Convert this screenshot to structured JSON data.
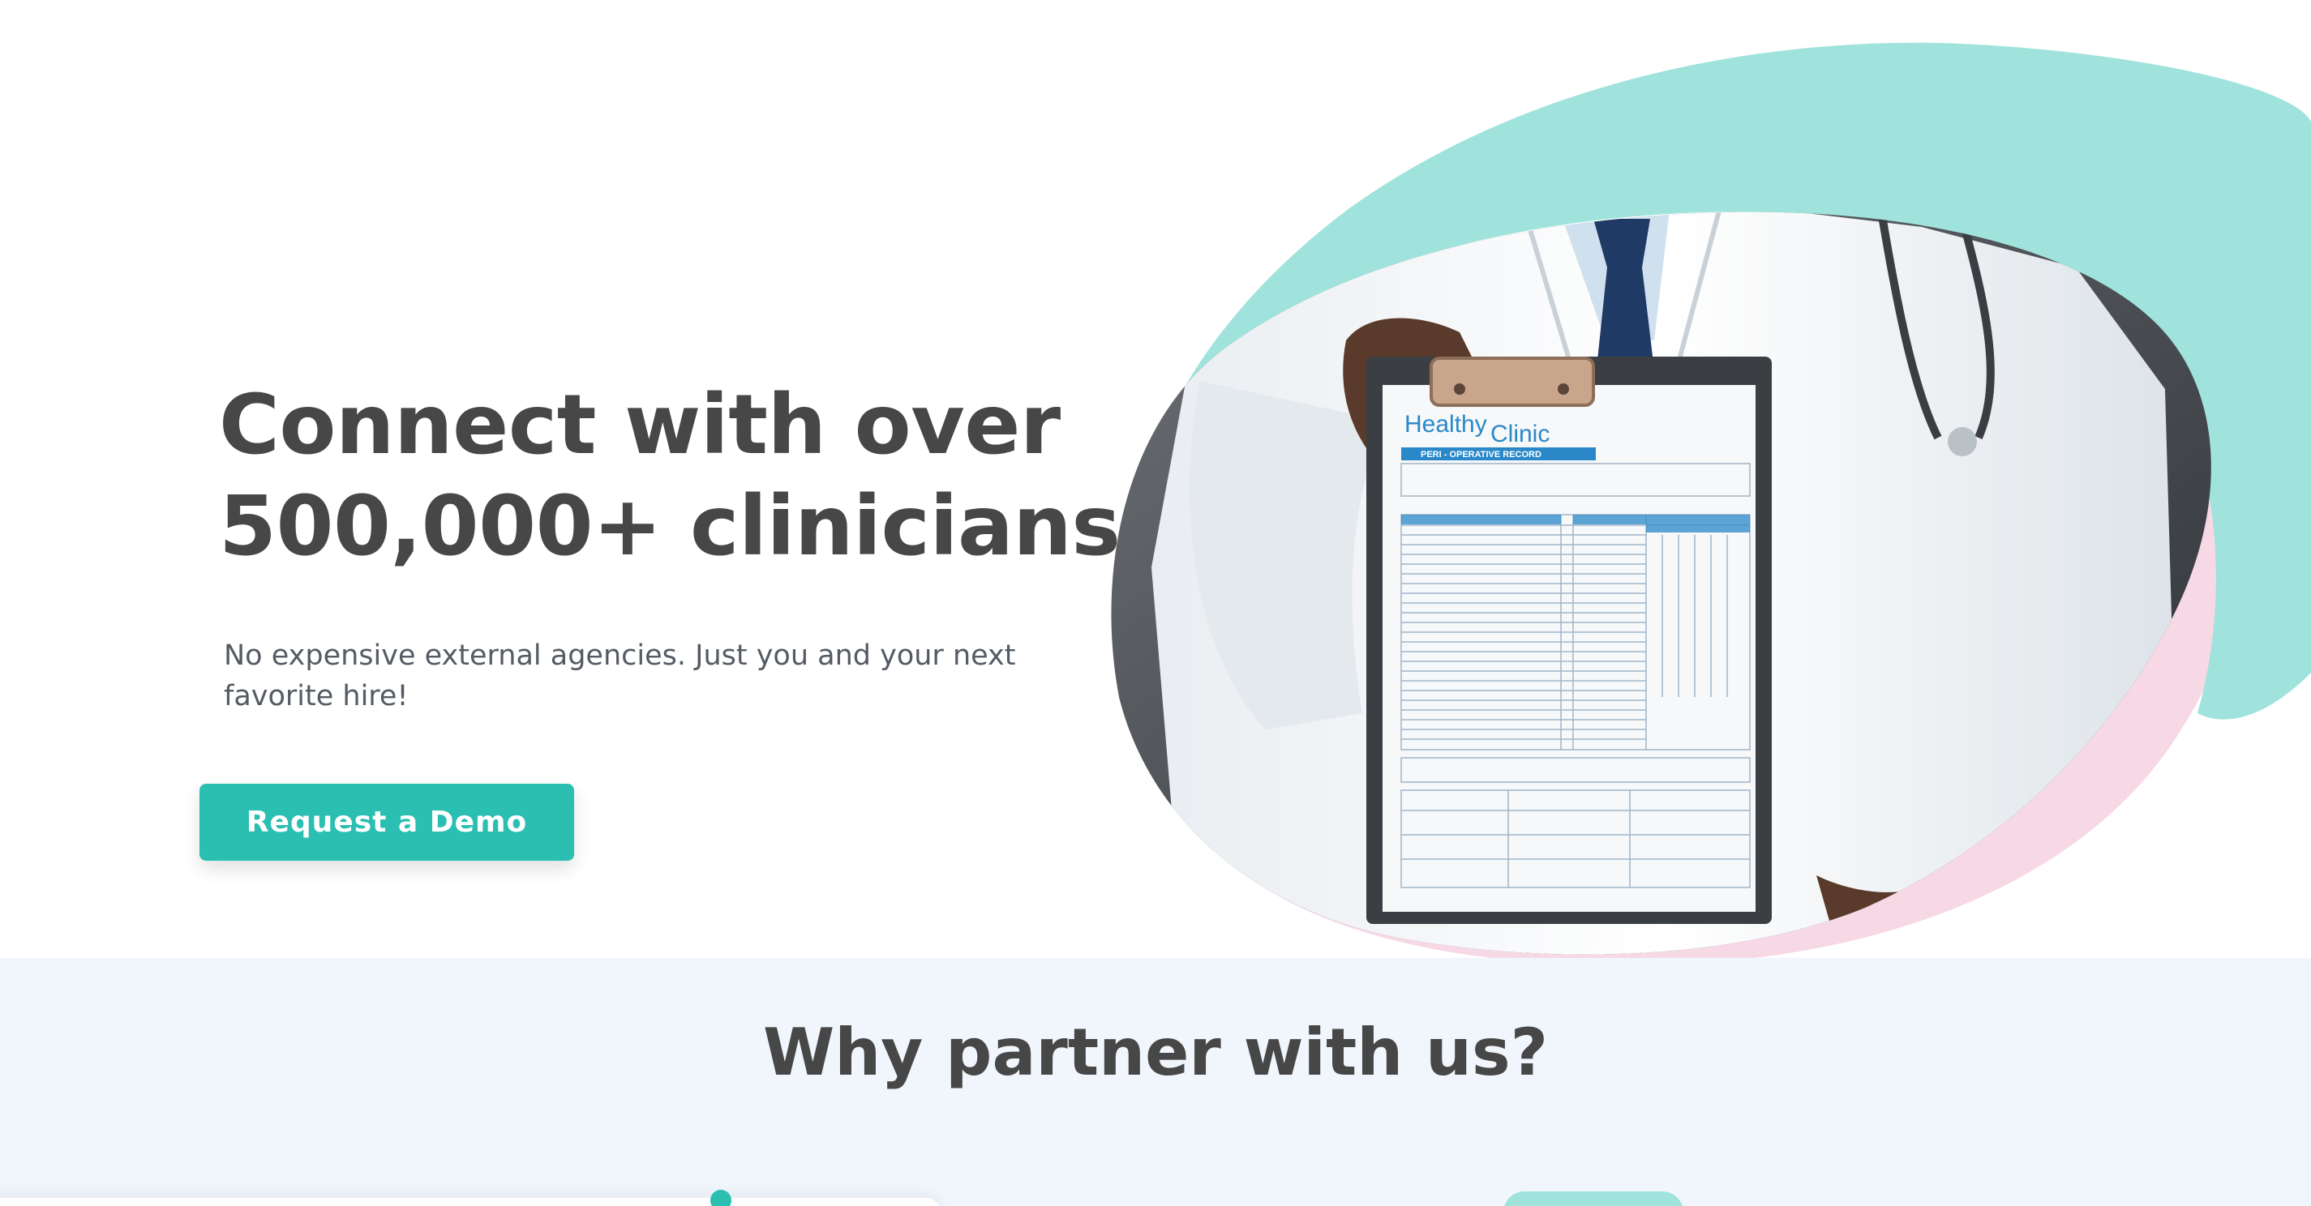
{
  "hero": {
    "title_line1": "Connect with over",
    "title_line2": "500,000+ clinicians.",
    "subtitle": "No expensive external agencies. Just you and your next favorite hire!",
    "cta_label": "Request a Demo"
  },
  "hero_image": {
    "clipboard_brand_1": "Healthy",
    "clipboard_brand_2": "Clinic",
    "clipboard_subtitle": "PERI - OPERATIVE RECORD"
  },
  "why_section": {
    "title": "Why partner with us?"
  },
  "colors": {
    "accent": "#2bbfb2",
    "teal_blob": "#9fe3dc",
    "pink_blob": "#f7d9e6",
    "heading_text": "#474747",
    "body_text": "#555b63",
    "section_bg": "#f0f6fc"
  }
}
